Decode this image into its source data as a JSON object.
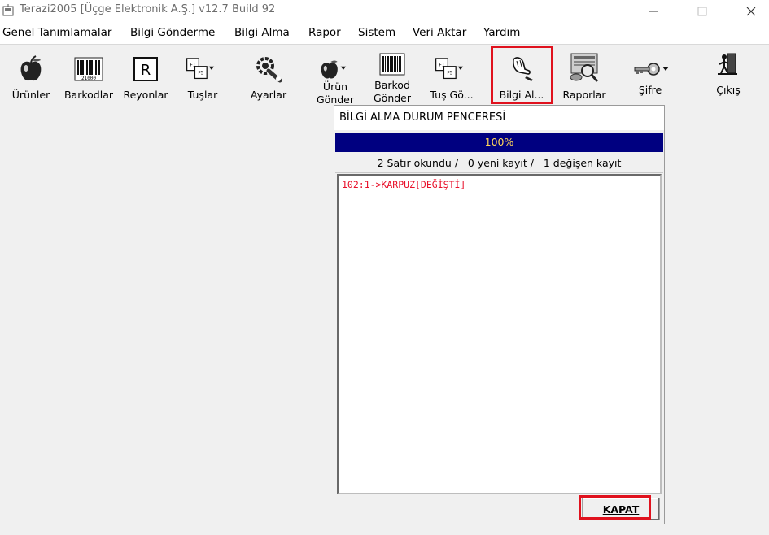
{
  "window": {
    "title": "Terazi2005 [Üçge Elektronik A.Ş.] v12.7 Build 92",
    "min_glyph": "—",
    "max_glyph": "☐",
    "close_glyph": "✕"
  },
  "menu": {
    "items": [
      {
        "label": "Genel Tanımlamalar"
      },
      {
        "label": "Bilgi Gönderme"
      },
      {
        "label": "Bilgi Alma"
      },
      {
        "label": "Rapor"
      },
      {
        "label": "Sistem"
      },
      {
        "label": "Veri Aktar"
      },
      {
        "label": "Yardım"
      }
    ]
  },
  "toolbar": {
    "urunler": "Ürünler",
    "barkodlar": "Barkodlar",
    "reyonlar": "Reyonlar",
    "tuslar": "Tuşlar",
    "ayarlar": "Ayarlar",
    "urun_gonder_1": "Ürün",
    "urun_gonder_2": "Gönder",
    "barkod_gonder_1": "Barkod",
    "barkod_gonder_2": "Gönder",
    "tus_gonder": "Tuş Gö...",
    "bilgi_al": "Bilgi Al...",
    "raporlar": "Raporlar",
    "sifre": "Şifre",
    "cikis": "Çıkış",
    "reyon_glyph": "R",
    "barcode_number": "21000"
  },
  "dialog": {
    "title": "BİLGİ ALMA DURUM PENCERESİ",
    "progress": 100,
    "progress_label": "100%",
    "status": "2 Satır okundu /   0 yeni kayıt /   1 değişen kayıt",
    "log_lines": [
      "102:1->KARPUZ[DEĞİŞTİ]"
    ],
    "close_label": "KAPAT"
  },
  "colors": {
    "highlight": "#e0121e",
    "progress_bar": "#000080",
    "progress_text": "#ffd65a",
    "log_text": "#e8102a"
  },
  "icons": [
    "app-icon",
    "apple-icon",
    "barcode-icon",
    "reyon-icon",
    "keyboard-icon",
    "settings-icon",
    "hand-icon",
    "report-icon",
    "key-icon",
    "exit-icon"
  ]
}
